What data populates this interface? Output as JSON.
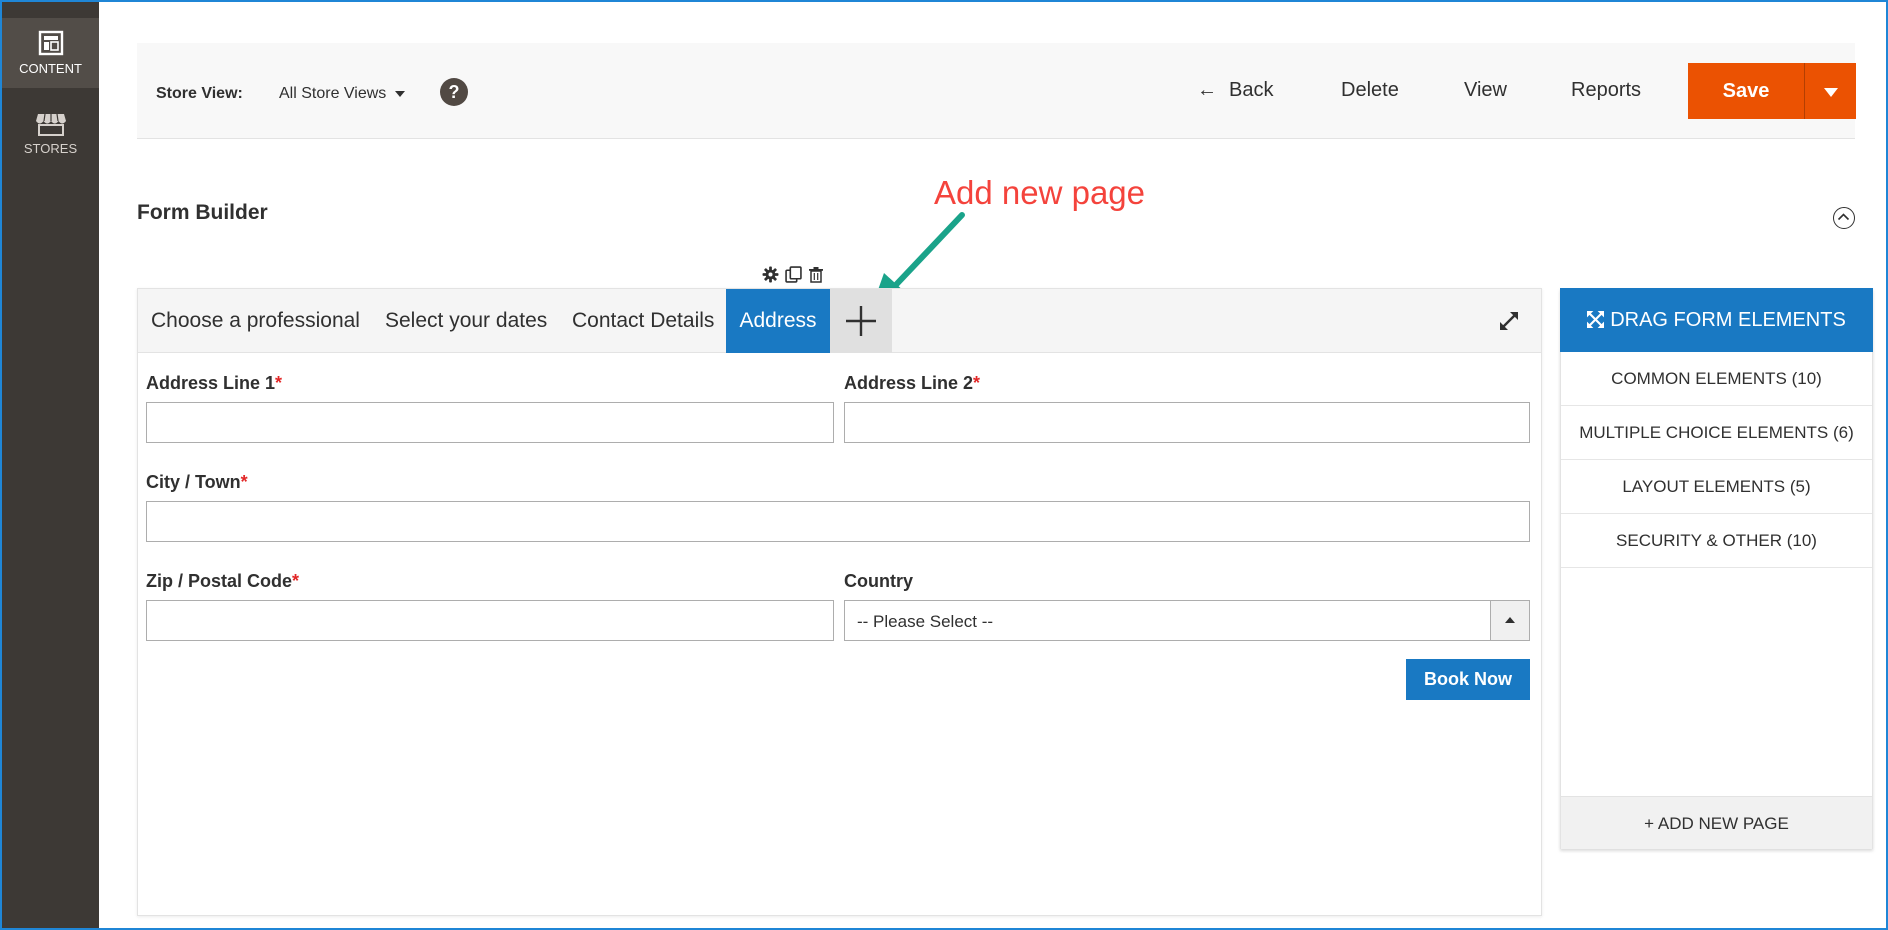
{
  "sidebar": {
    "items": [
      {
        "label": "CONTENT",
        "icon": "layout-icon",
        "active": true
      },
      {
        "label": "STORES",
        "icon": "store-icon",
        "active": false
      }
    ]
  },
  "header": {
    "store_view_label": "Store View:",
    "store_view_value": "All Store Views",
    "help_glyph": "?",
    "back_label": "Back",
    "delete_label": "Delete",
    "view_label": "View",
    "reports_label": "Reports",
    "save_label": "Save"
  },
  "section": {
    "title": "Form Builder"
  },
  "annotation": {
    "text": "Add new page",
    "color": "#f4433c",
    "arrow_color": "#1aa38a"
  },
  "tabs": [
    {
      "label": "Choose a professional",
      "active": false
    },
    {
      "label": "Select your dates",
      "active": false
    },
    {
      "label": "Contact Details",
      "active": false
    },
    {
      "label": "Address",
      "active": true
    }
  ],
  "form": {
    "address1_label": "Address Line 1",
    "address2_label": "Address Line 2",
    "city_label": "City / Town",
    "zip_label": "Zip / Postal Code",
    "country_label": "Country",
    "country_value": "-- Please Select --",
    "required_mark": "*",
    "book_label": "Book Now"
  },
  "panel": {
    "header": "DRAG FORM ELEMENTS",
    "items": [
      "COMMON ELEMENTS (10)",
      "MULTIPLE CHOICE ELEMENTS (6)",
      "LAYOUT ELEMENTS (5)",
      "SECURITY & OTHER (10)"
    ],
    "add_page": "+ ADD NEW PAGE"
  },
  "colors": {
    "accent_blue": "#1979c3",
    "save_orange": "#eb5202",
    "sidebar_dark": "#3d3935",
    "required_red": "#e22626"
  }
}
